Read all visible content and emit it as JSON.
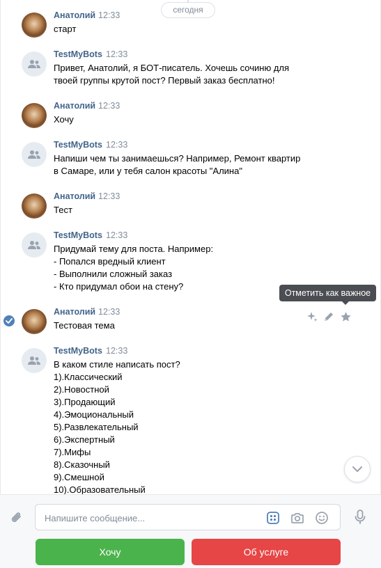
{
  "feed": {
    "date_label": "сегодня"
  },
  "messages": [
    {
      "author": "Анатолий",
      "time": "12:33",
      "type": "user",
      "lines": [
        "старт"
      ]
    },
    {
      "author": "TestMyBots",
      "time": "12:33",
      "type": "bot",
      "lines": [
        "Привет, Анатолий, я БОТ-писатель. Хочешь сочиню для",
        "твоей группы крутой пост? Первый заказ бесплатно!"
      ]
    },
    {
      "author": "Анатолий",
      "time": "12:33",
      "type": "user",
      "lines": [
        "Хочу"
      ]
    },
    {
      "author": "TestMyBots",
      "time": "12:33",
      "type": "bot",
      "lines": [
        "Напиши чем ты занимаешься? Например, Ремонт квартир",
        "в Самаре, или у тебя салон красоты \"Алина\""
      ]
    },
    {
      "author": "Анатолий",
      "time": "12:33",
      "type": "user",
      "lines": [
        "Тест"
      ]
    },
    {
      "author": "TestMyBots",
      "time": "12:33",
      "type": "bot",
      "lines": [
        "Придумай тему для поста. Например:",
        "- Попался вредный клиент",
        "- Выполнили сложный заказ",
        "- Кто придумал обои на стену?"
      ]
    },
    {
      "author": "Анатолий",
      "time": "12:33",
      "type": "user",
      "lines": [
        "Тестовая тема"
      ]
    },
    {
      "author": "TestMyBots",
      "time": "12:33",
      "type": "bot",
      "lines": [
        "В каком стиле написать пост?",
        "1).Классический",
        "2).Новостной",
        "3).Продающий",
        "4).Эмоциональный",
        "5).Развлекательный",
        "6).Экспертный",
        "7).Мифы",
        "8).Сказочный",
        "9).Смешной",
        "10).Образовательный"
      ]
    }
  ],
  "tooltip": {
    "text": "Отметить как важное"
  },
  "hover_actions": {
    "icons": [
      "sparkle-icon",
      "pencil-icon",
      "star-icon"
    ]
  },
  "composer": {
    "placeholder": "Напишите сообщение...",
    "value": ""
  },
  "keyboard": {
    "buttons": [
      {
        "label": "Хочу",
        "color": "#4bb34b"
      },
      {
        "label": "Об услуге",
        "color": "#e64646"
      }
    ]
  },
  "colors": {
    "author": "#42648b",
    "meta": "#818c99",
    "accent": "#5181b8"
  }
}
